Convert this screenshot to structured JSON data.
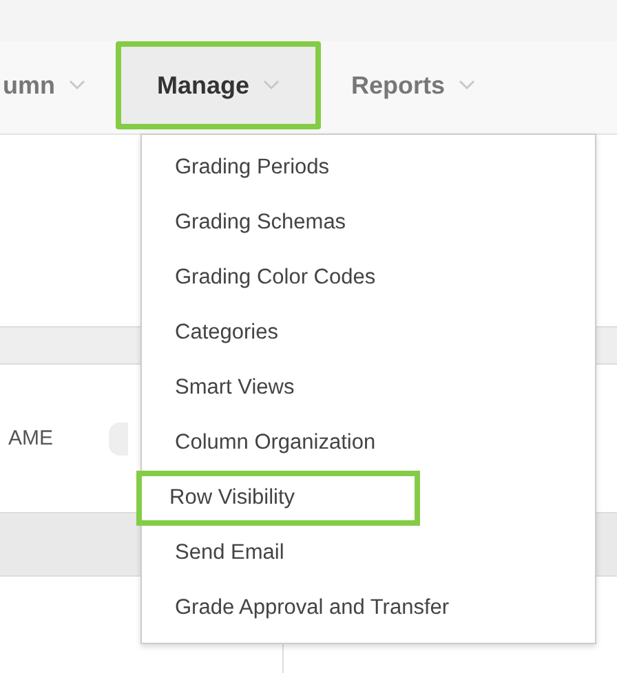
{
  "nav": [
    {
      "label": "umn",
      "selected": false,
      "highlighted": false
    },
    {
      "label": "Manage",
      "selected": true,
      "highlighted": true
    },
    {
      "label": "Reports",
      "selected": false,
      "highlighted": false
    }
  ],
  "menu": {
    "items": [
      {
        "label": "Grading Periods",
        "highlighted": false
      },
      {
        "label": "Grading Schemas",
        "highlighted": false
      },
      {
        "label": "Grading Color Codes",
        "highlighted": false
      },
      {
        "label": "Categories",
        "highlighted": false
      },
      {
        "label": "Smart Views",
        "highlighted": false
      },
      {
        "label": "Column Organization",
        "highlighted": false
      },
      {
        "label": "Row Visibility",
        "highlighted": true
      },
      {
        "label": "Send Email",
        "highlighted": false
      },
      {
        "label": "Grade Approval and Transfer",
        "highlighted": false
      }
    ]
  },
  "table": {
    "column_header": "AME"
  }
}
